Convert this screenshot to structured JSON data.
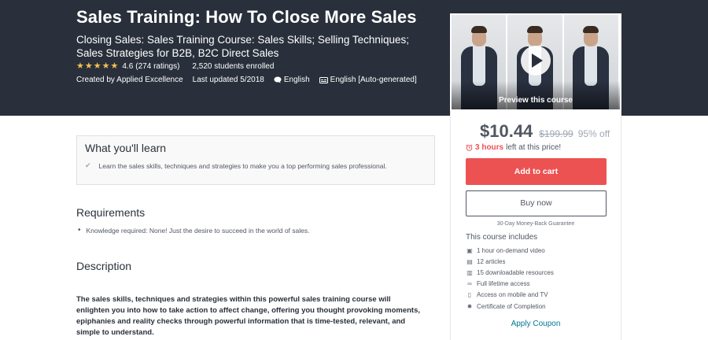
{
  "course": {
    "title": "Sales Training: How To Close More Sales",
    "subtitle": "Closing Sales: Sales Training Course: Sales Skills; Selling Techniques; Sales Strategies for B2B, B2C Direct Sales",
    "rating": "4.6",
    "stars": 4.5,
    "rating_count": "(274 ratings)",
    "students": "2,520 students enrolled",
    "created_by": "Created by Applied Excellence",
    "last_updated": "Last updated 5/2018",
    "language": "English",
    "captions": "English [Auto-generated]"
  },
  "preview": {
    "label": "Preview this course"
  },
  "purchase": {
    "price": "$10.44",
    "original_price": "$199.99",
    "discount": "95% off",
    "timer_hours": "3 hours",
    "timer_rest": "left at this price!",
    "add_to_cart": "Add to cart",
    "buy_now": "Buy now",
    "guarantee": "30-Day Money-Back Guarantee",
    "includes_title": "This course includes",
    "includes": [
      {
        "icon": "video-icon",
        "glyph": "▣",
        "label": "1 hour on-demand video"
      },
      {
        "icon": "article-icon",
        "glyph": "▤",
        "label": "12 articles"
      },
      {
        "icon": "download-icon",
        "glyph": "▥",
        "label": "15 downloadable resources"
      },
      {
        "icon": "infinity-icon",
        "glyph": "∞",
        "label": "Full lifetime access"
      },
      {
        "icon": "mobile-icon",
        "glyph": "▯",
        "label": "Access on mobile and TV"
      },
      {
        "icon": "certificate-icon",
        "glyph": "✹",
        "label": "Certificate of Completion"
      }
    ],
    "apply_coupon": "Apply Coupon"
  },
  "learn": {
    "title": "What you'll learn",
    "items": [
      "Learn the sales skills, techniques and strategies to make you a top performing sales professional."
    ]
  },
  "requirements": {
    "title": "Requirements",
    "items": [
      "Knowledge required: None! Just the desire to succeed in the world of sales."
    ]
  },
  "description": {
    "title": "Description",
    "text": "The sales skills, techniques and strategies within this powerful sales training course will enlighten you into how to take action to affect change, offering you thought provoking moments, epiphanies and reality checks through powerful information that is time-tested, relevant, and simple to understand."
  },
  "colors": {
    "header_bg": "#29303b",
    "accent_red": "#ec5252",
    "star": "#f4c150",
    "link": "#007791"
  }
}
